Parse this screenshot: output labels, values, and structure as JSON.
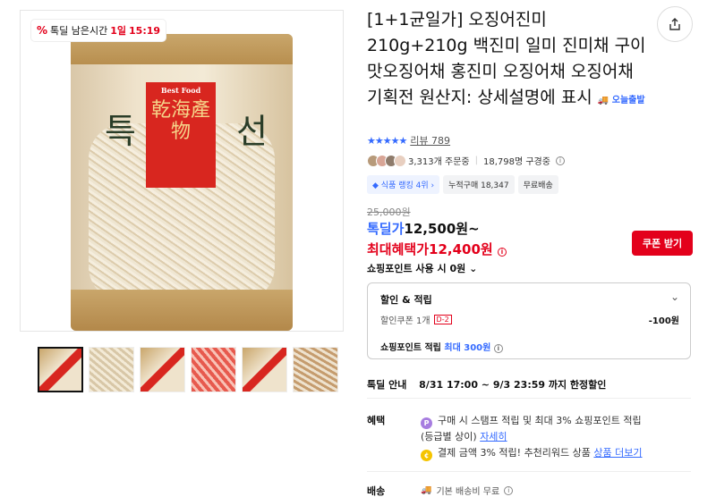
{
  "badge": {
    "label": "톡딜 남은시간",
    "day": "1일",
    "time": "15:19",
    "icon": "discount-percent-icon"
  },
  "product_image": {
    "brand_top": "Best Food",
    "left_char": "특",
    "right_char": "선",
    "label_han": "乾海產物"
  },
  "thumbnails": [
    "thumb-1",
    "thumb-2",
    "thumb-3",
    "thumb-4",
    "thumb-5",
    "thumb-6"
  ],
  "title": {
    "text": "[1+1균일가] 오징어진미 210g+210g 백진미 일미 진미채 구이맛오징어채 홍진미 오징어채 오징어채 기획전 원산지: 상세설명에 표시",
    "today_tag": "오늘출발"
  },
  "rating": {
    "stars": "★★★★★",
    "review": "리뷰 789"
  },
  "social": {
    "orders": "3,313개 주문중",
    "viewers": "18,798명 구경중"
  },
  "chips": [
    "식품 랭킹 4위",
    "누적구매 18,347",
    "무료배송"
  ],
  "price": {
    "original": "25,000원",
    "deal_label": "톡딜가",
    "deal_price": "12,500원~",
    "max_label": "최대혜택가",
    "max_price": "12,400원",
    "coupon_button": "쿠폰 받기",
    "point_use": "쇼핑포인트 사용 시 0원"
  },
  "discount": {
    "title": "할인 & 적립",
    "coupon": "할인쿠폰 1개",
    "d_tag": "D-2",
    "coupon_amount": "-100원",
    "point_label": "쇼핑포인트 적립",
    "point_value": "최대 300원"
  },
  "deal_info": {
    "label": "톡딜 안내",
    "period": "8/31 17:00 ~ 9/3 23:59 까지 한정할인"
  },
  "benefit": {
    "label": "혜택",
    "line1": "구매 시 스탬프 적립 및 최대 3% 쇼핑포인트 적립",
    "line1b": "(등급별 상이)",
    "line1_link": "자세히",
    "line2": "결제 금액 3% 적립! 추천리워드 상품",
    "line2_link": "상품 더보기"
  },
  "shipping": {
    "label": "배송",
    "text": "기본 배송비 무료"
  },
  "colors": {
    "accent_red": "#e3001b",
    "accent_blue": "#346aff"
  }
}
